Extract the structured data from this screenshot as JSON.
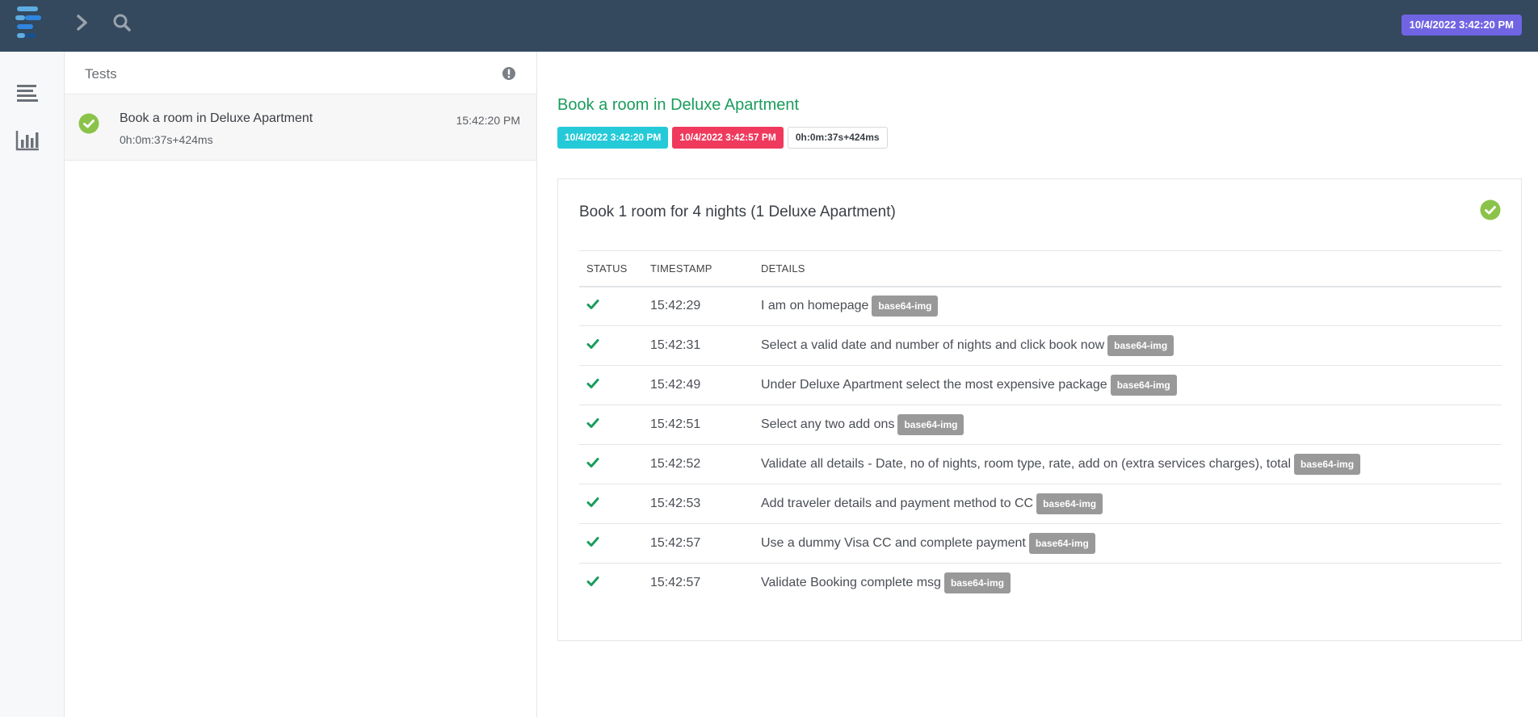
{
  "header": {
    "logo_icon": "extent-logo-icon",
    "nav_icons": [
      "chevron-right-icon",
      "search-icon"
    ],
    "date_badge": "10/4/2022 3:42:20 PM",
    "colors": {
      "bar": "#34495e",
      "date_badge": "#7164e3"
    }
  },
  "sidebar": {
    "items": [
      {
        "icon": "list-align-icon"
      },
      {
        "icon": "bar-chart-icon"
      }
    ]
  },
  "test_list": {
    "title": "Tests",
    "info_icon": "exclamation-circle-icon",
    "items": [
      {
        "name": "Book a room in Deluxe Apartment",
        "duration": "0h:0m:37s+424ms",
        "time": "15:42:20 PM",
        "status_icon": "check-circle-icon",
        "status_color": "#8bc34a"
      }
    ]
  },
  "detail": {
    "title": "Book a room in Deluxe Apartment",
    "start": "10/4/2022 3:42:20 PM",
    "end": "10/4/2022 3:42:57 PM",
    "duration": "0h:0m:37s+424ms",
    "colors": {
      "title": "#1a9c5c",
      "start": "#25cad9",
      "end": "#ef3a5d"
    },
    "node": {
      "name": "Book 1 room for 4 nights (1 Deluxe Apartment)",
      "status_icon": "check-circle-icon",
      "columns": {
        "status": "Status",
        "timestamp": "Timestamp",
        "details": "Details"
      },
      "logs": [
        {
          "status_icon": "check-icon",
          "time": "15:42:29",
          "details": "I am on homepage",
          "attachment": "base64-img"
        },
        {
          "status_icon": "check-icon",
          "time": "15:42:31",
          "details": "Select a valid date and number of nights and click book now",
          "attachment": "base64-img"
        },
        {
          "status_icon": "check-icon",
          "time": "15:42:49",
          "details": "Under Deluxe Apartment select the most expensive package",
          "attachment": "base64-img"
        },
        {
          "status_icon": "check-icon",
          "time": "15:42:51",
          "details": "Select any two add ons",
          "attachment": "base64-img"
        },
        {
          "status_icon": "check-icon",
          "time": "15:42:52",
          "details": "Validate all details - Date, no of nights, room type, rate, add on (extra services charges), total",
          "attachment": "base64-img"
        },
        {
          "status_icon": "check-icon",
          "time": "15:42:53",
          "details": "Add traveler details and payment method to CC",
          "attachment": "base64-img"
        },
        {
          "status_icon": "check-icon",
          "time": "15:42:57",
          "details": "Use a dummy Visa CC and complete payment",
          "attachment": "base64-img"
        },
        {
          "status_icon": "check-icon",
          "time": "15:42:57",
          "details": "Validate Booking complete msg",
          "attachment": "base64-img"
        }
      ]
    }
  }
}
